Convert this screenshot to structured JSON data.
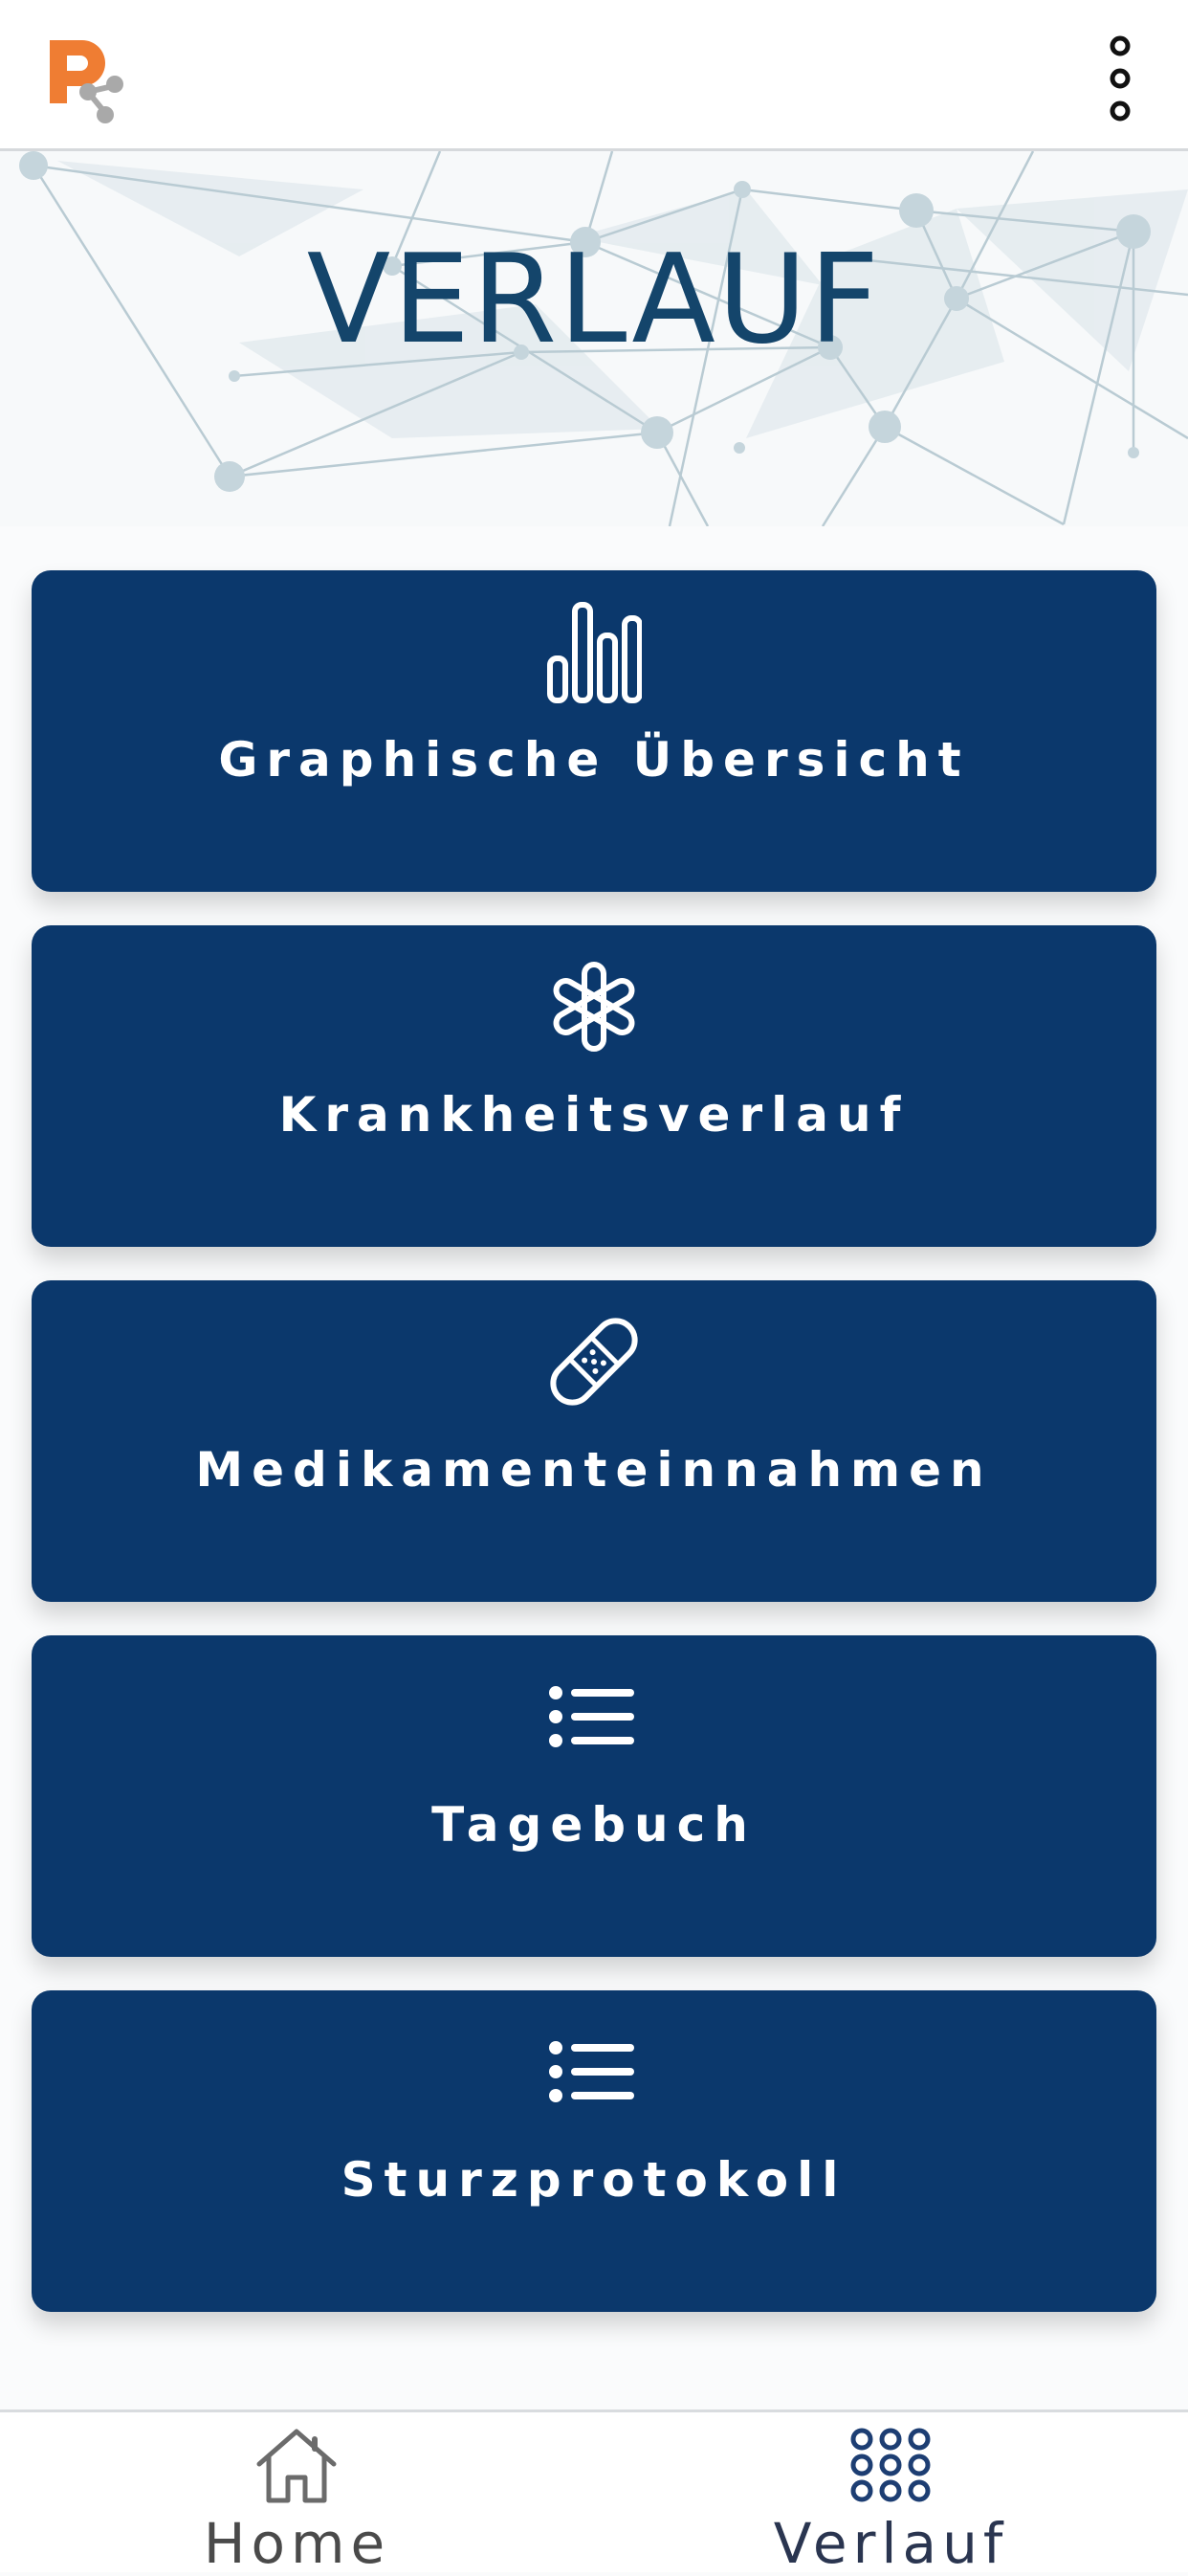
{
  "header": {
    "logo_icon": "p-share-logo-icon",
    "menu_icon": "more-vertical-icon"
  },
  "hero": {
    "title": "VERLAUF"
  },
  "menu": [
    {
      "label": "Graphische Übersicht",
      "icon": "bar-chart-icon"
    },
    {
      "label": "Krankheitsverlauf",
      "icon": "asterisk-icon"
    },
    {
      "label": "Medikamenteinnahmen",
      "icon": "bandage-icon"
    },
    {
      "label": "Tagebuch",
      "icon": "list-icon"
    },
    {
      "label": "Sturzprotokoll",
      "icon": "list-icon"
    }
  ],
  "bottom_nav": {
    "items": [
      {
        "label": "Home",
        "icon": "home-icon"
      },
      {
        "label": "Verlauf",
        "icon": "grid-dots-icon",
        "active": true
      }
    ]
  },
  "colors": {
    "primary": "#0b386c",
    "title": "#14456b",
    "logo_orange": "#ef7d33",
    "logo_gray": "#a9a9a9"
  }
}
